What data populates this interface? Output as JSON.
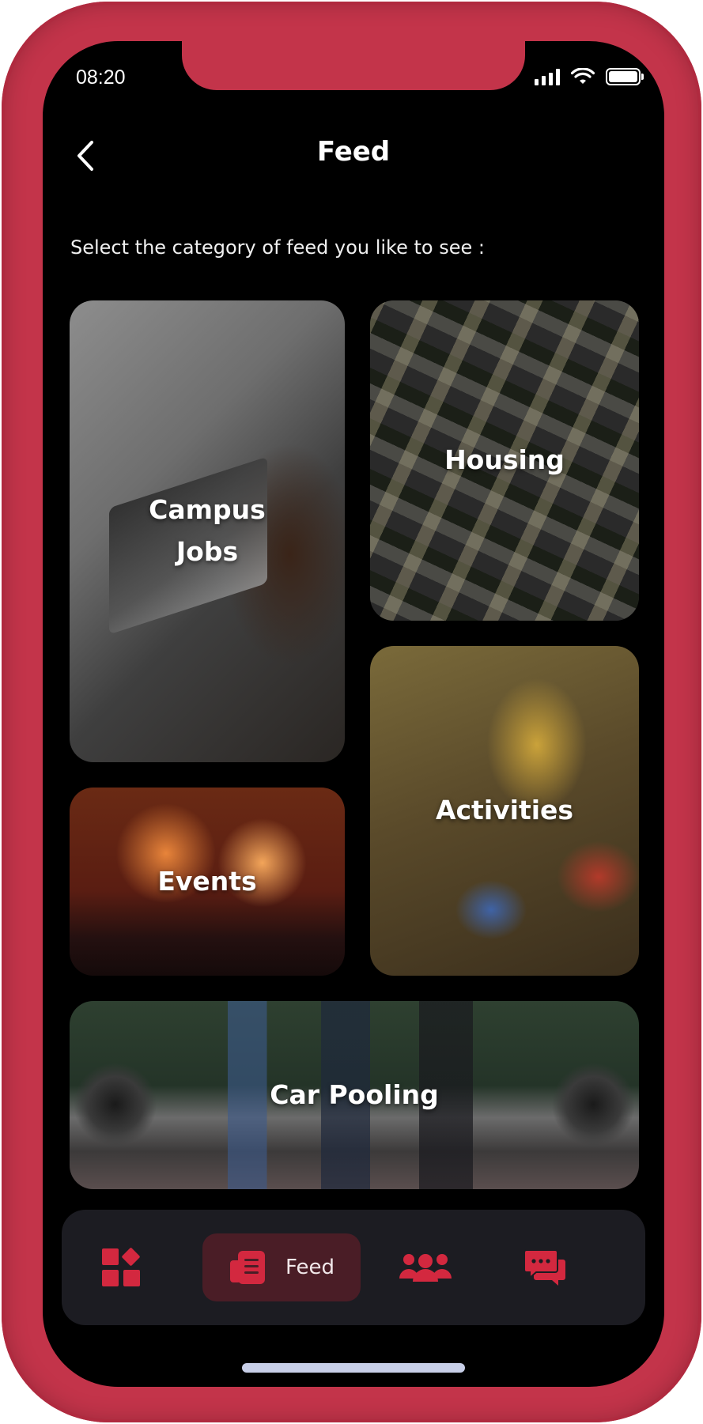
{
  "status_bar": {
    "time": "08:20"
  },
  "header": {
    "title": "Feed"
  },
  "prompt": "Select the category of feed you like to see :",
  "categories": {
    "campus_jobs": {
      "line1": "Campus",
      "line2": "Jobs"
    },
    "housing": "Housing",
    "events": "Events",
    "activities": "Activities",
    "car_pooling": "Car Pooling"
  },
  "nav": {
    "active_label": "Feed",
    "items": [
      "dashboard-icon",
      "feed-icon",
      "group-icon",
      "chat-icon"
    ]
  },
  "colors": {
    "accent": "#c3344a",
    "icon_red": "#d3283f",
    "nav_bg": "#1c1c22",
    "nav_active_bg": "#4a1d26"
  }
}
